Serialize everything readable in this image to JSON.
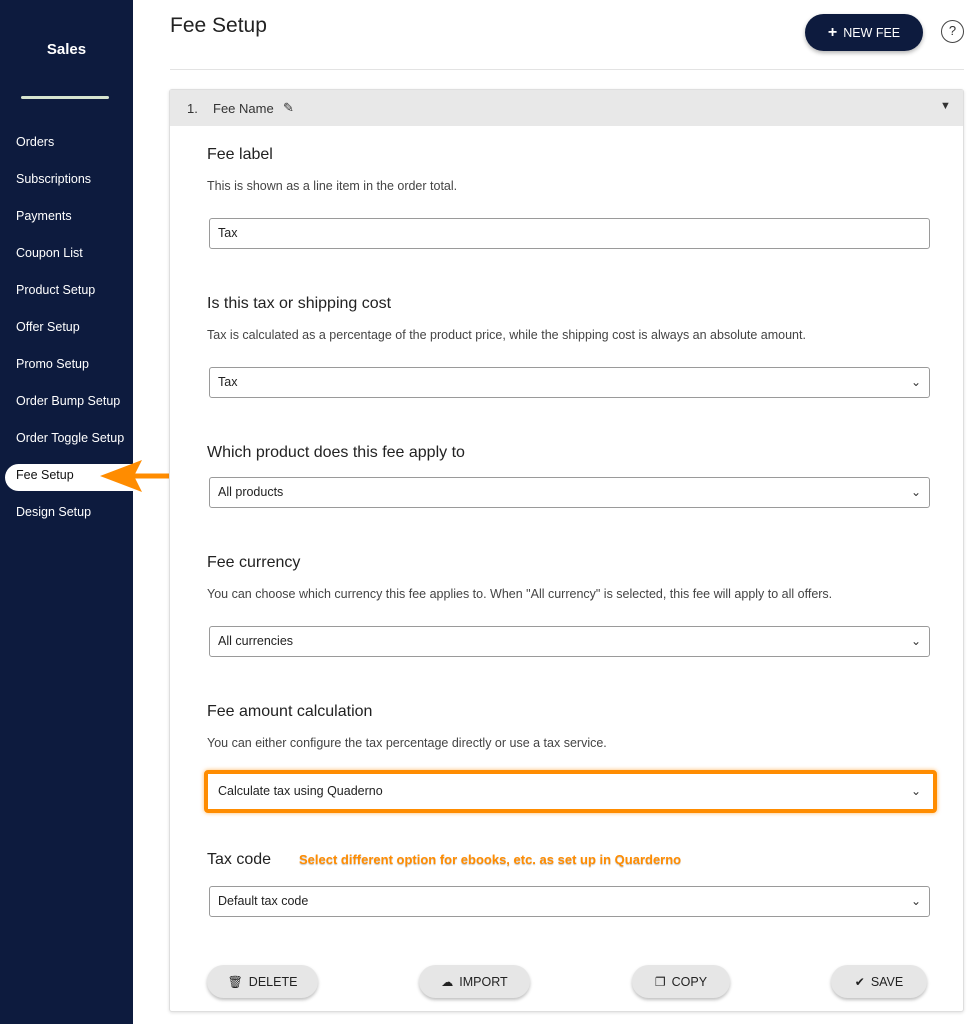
{
  "sidebar": {
    "title": "Sales",
    "items": [
      {
        "label": "Orders"
      },
      {
        "label": "Subscriptions"
      },
      {
        "label": "Payments"
      },
      {
        "label": "Coupon List"
      },
      {
        "label": "Product Setup"
      },
      {
        "label": "Offer Setup"
      },
      {
        "label": "Promo Setup"
      },
      {
        "label": "Order Bump Setup"
      },
      {
        "label": "Order Toggle Setup"
      },
      {
        "label": "Fee Setup"
      },
      {
        "label": "Design Setup"
      }
    ]
  },
  "header": {
    "title": "Fee Setup",
    "new_fee_label": "NEW FEE",
    "help": "?"
  },
  "panel": {
    "number": "1.",
    "name": "Fee Name",
    "fee_label": {
      "title": "Fee label",
      "description": "This is shown as a line item in the order total.",
      "value": "Tax"
    },
    "type": {
      "title": "Is this tax or shipping cost",
      "description": "Tax is calculated as a percentage of the product price, while the shipping cost is always an absolute amount.",
      "value": "Tax"
    },
    "product": {
      "title": "Which product does this fee apply to",
      "value": "All products"
    },
    "currency": {
      "title": "Fee currency",
      "description": "You can choose which currency this fee applies to. When \"All currency\" is selected, this fee will apply to all offers.",
      "value": "All currencies"
    },
    "calculation": {
      "title": "Fee amount calculation",
      "description": "You can either configure the tax percentage directly or use a tax service.",
      "value": "Calculate tax using Quaderno"
    },
    "tax_code": {
      "title": "Tax code",
      "annotation": "Select different option for ebooks, etc. as set up in Quarderno",
      "value": "Default tax code"
    },
    "buttons": {
      "delete": "DELETE",
      "import": "IMPORT",
      "copy": "COPY",
      "save": "SAVE"
    }
  },
  "colors": {
    "sidebar_bg": "#0d1b3e",
    "accent_annotation": "#ff8c00",
    "primary_button": "#0d1b3e"
  }
}
